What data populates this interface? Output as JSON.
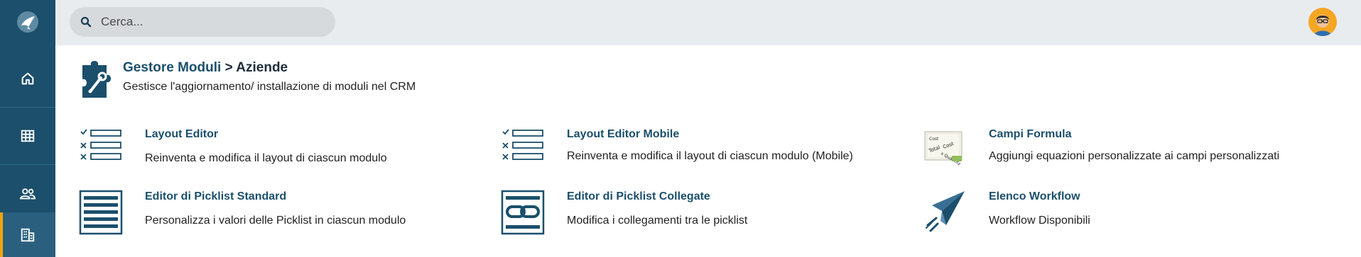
{
  "search": {
    "placeholder": "Cerca..."
  },
  "sidebar": {
    "items": [
      {
        "name": "logo"
      },
      {
        "name": "home"
      },
      {
        "name": "apps"
      },
      {
        "name": "users"
      },
      {
        "name": "company",
        "active": true
      }
    ]
  },
  "header": {
    "module": "Gestore Moduli",
    "separator": ">",
    "current": "Aziende",
    "subtitle": "Gestisce l'aggiornamento/ installazione di moduli nel CRM"
  },
  "tools": [
    {
      "title": "Layout Editor",
      "description": "Reinventa e modifica il layout di ciascun modulo",
      "icon": "layout-checklist-icon"
    },
    {
      "title": "Layout Editor Mobile",
      "description": "Reinventa e modifica il layout di ciascun modulo (Mobile)",
      "icon": "layout-checklist-icon"
    },
    {
      "title": "Campi Formula",
      "description": "Aggiungi equazioni personalizzate ai campi personalizzati",
      "icon": "formula-icon"
    },
    {
      "title": "Editor di Picklist Standard",
      "description": "Personalizza i valori delle Picklist in ciascun modulo",
      "icon": "picklist-icon"
    },
    {
      "title": "Editor di Picklist Collegate",
      "description": "Modifica i collegamenti tra le picklist",
      "icon": "linked-picklist-icon"
    },
    {
      "title": "Elenco Workflow",
      "description": "Workflow Disponibili",
      "icon": "paper-plane-icon"
    }
  ],
  "colors": {
    "sidebar": "#1b4f6b",
    "accent": "#f0a30a",
    "link": "#1b4f6b"
  }
}
